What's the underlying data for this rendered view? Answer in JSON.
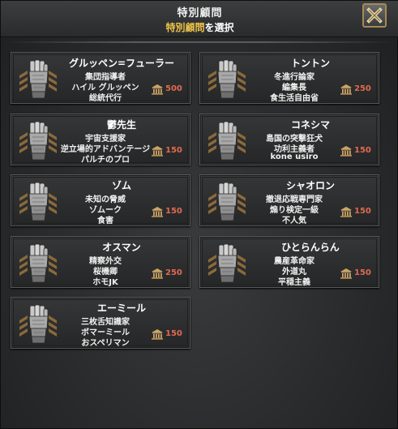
{
  "window": {
    "title": "特別顧問",
    "subtitle_highlight": "特別顧問",
    "subtitle_rest": "を選択",
    "close_icon": "close-x-icon"
  },
  "advisors": [
    {
      "name": "グルッペン=フューラー",
      "traits": [
        "集団指導者",
        "ハイル グルッペン",
        "総統代行"
      ],
      "cost": "500"
    },
    {
      "name": "トントン",
      "traits": [
        "冬進行論家",
        "編集長",
        "食生活自由省"
      ],
      "cost": "250"
    },
    {
      "name": "鬱先生",
      "traits": [
        "宇宙支援家",
        "逆立場的アドバンテージ",
        "パルチのプロ"
      ],
      "cost": "150"
    },
    {
      "name": "コネシマ",
      "traits": [
        "島国の突撃狂犬",
        "功利主義者",
        "kone usiro"
      ],
      "cost": "150"
    },
    {
      "name": "ゾム",
      "traits": [
        "未知の脅威",
        "ゾムーク",
        "食害"
      ],
      "cost": "150"
    },
    {
      "name": "シャオロン",
      "traits": [
        "撤退応戦専門家",
        "煽り検定一級",
        "不人気"
      ],
      "cost": "150"
    },
    {
      "name": "オスマン",
      "traits": [
        "精察外交",
        "桜機卿",
        "ホモJK"
      ],
      "cost": "250"
    },
    {
      "name": "ひとらんらん",
      "traits": [
        "農産革命家",
        "外道丸",
        "平穏主義"
      ],
      "cost": "150"
    },
    {
      "name": "エーミール",
      "traits": [
        "三枚舌知識家",
        "ボマーミール",
        "おスペリマン"
      ],
      "cost": "150"
    }
  ],
  "colors": {
    "cost_text": "#e06a50",
    "highlight": "#f0c64a",
    "frame": "#a38b55"
  }
}
